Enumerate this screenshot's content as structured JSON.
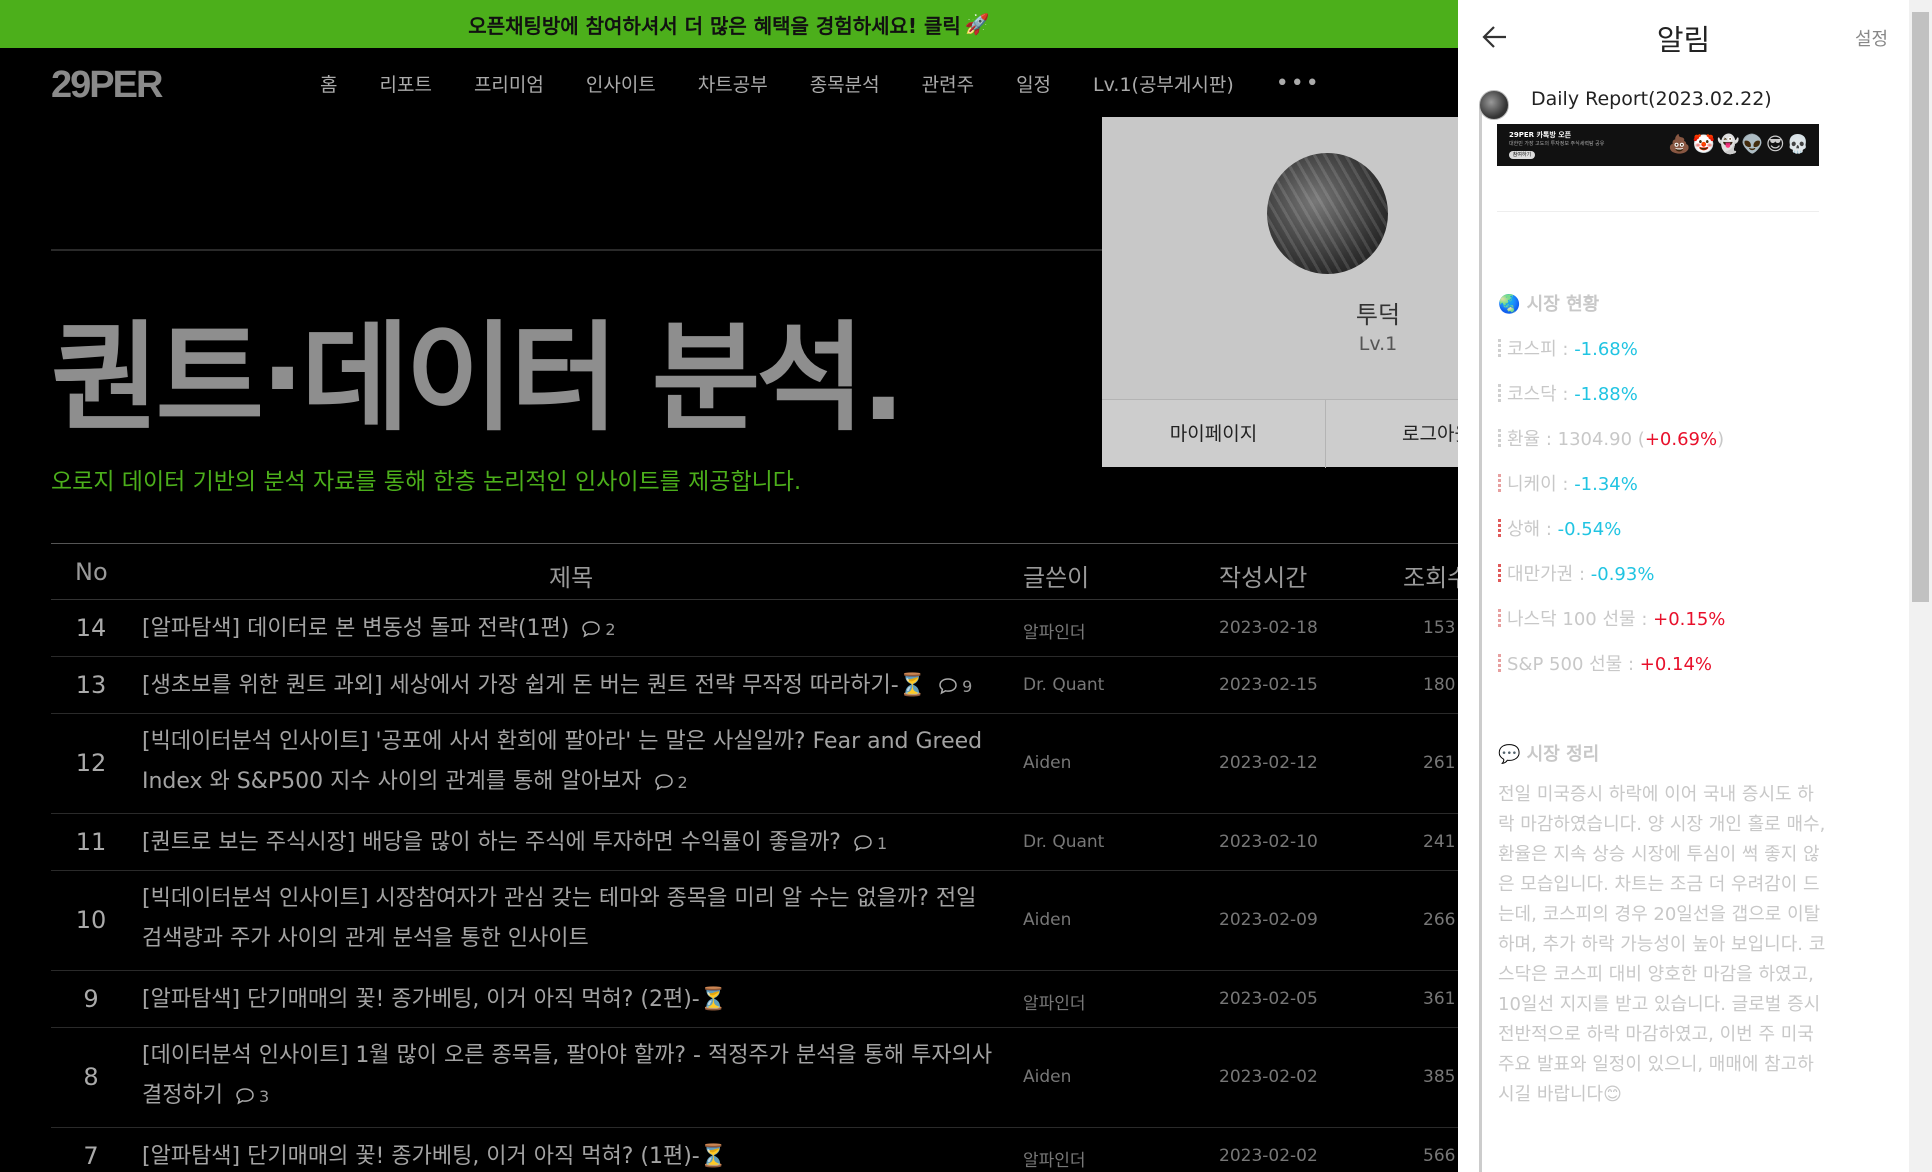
{
  "promo": {
    "text": "오픈채팅방에 참여하셔서 더 많은 혜택을 경험하세요! 클릭",
    "icon": "rocket-icon",
    "bg": "#4caf1b"
  },
  "header": {
    "logo": "29PER",
    "nav": [
      "홈",
      "리포트",
      "프리미엄",
      "인사이트",
      "차트공부",
      "종목분석",
      "관련주",
      "일정",
      "Lv.1(공부게시판)"
    ],
    "more": "•••"
  },
  "hero": {
    "title": "퀀트·데이터 분석.",
    "subtitle": "오로지 데이터 기반의 분석 자료를 통해 한층 논리적인 인사이트를 제공합니다."
  },
  "table": {
    "headers": {
      "no": "No",
      "title": "제목",
      "author": "글쓴이",
      "date": "작성시간",
      "views": "조회수"
    },
    "rows": [
      {
        "no": "14",
        "title": "[알파탐색] 데이터로 본 변동성 돌파 전략(1편)",
        "comments": "2",
        "author": "알파인더",
        "date": "2023-02-18",
        "views": "153"
      },
      {
        "no": "13",
        "title": "[생초보를 위한 퀀트 과외] 세상에서 가장 쉽게 돈 버는 퀀트 전략 무작정 따라하기-⏳",
        "comments": "9",
        "author": "Dr. Quant",
        "date": "2023-02-15",
        "views": "180"
      },
      {
        "no": "12",
        "title": "[빅데이터분석 인사이트] '공포에 사서 환희에 팔아라' 는 말은 사실일까? Fear and Greed Index 와 S&P500 지수 사이의 관계를 통해 알아보자",
        "comments": "2",
        "author": "Aiden",
        "date": "2023-02-12",
        "views": "261"
      },
      {
        "no": "11",
        "title": "[퀀트로 보는 주식시장] 배당을 많이 하는 주식에 투자하면 수익률이 좋을까?",
        "comments": "1",
        "author": "Dr. Quant",
        "date": "2023-02-10",
        "views": "241"
      },
      {
        "no": "10",
        "title": "[빅데이터분석 인사이트] 시장참여자가 관심 갖는 테마와 종목을 미리 알 수는 없을까? 전일 검색량과 주가 사이의 관계 분석을 통한 인사이트",
        "comments": "",
        "author": "Aiden",
        "date": "2023-02-09",
        "views": "266"
      },
      {
        "no": "9",
        "title": "[알파탐색] 단기매매의 꽃! 종가베팅, 이거 아직 먹혀? (2편)-⏳",
        "comments": "",
        "author": "알파인더",
        "date": "2023-02-05",
        "views": "361"
      },
      {
        "no": "8",
        "title": "[데이터분석 인사이트] 1월 많이 오른 종목들, 팔아야 할까? - 적정주가 분석을 통해 투자의사 결정하기",
        "comments": "3",
        "author": "Aiden",
        "date": "2023-02-02",
        "views": "385"
      },
      {
        "no": "7",
        "title": "[알파탐색] 단기매매의 꽃! 종가베팅, 이거 아직 먹혀? (1편)-⏳",
        "comments": "",
        "author": "알파인더",
        "date": "2023-02-02",
        "views": "566"
      }
    ]
  },
  "profile": {
    "name": "투덕",
    "level": "Lv.1",
    "mypage": "마이페이지",
    "logout": "로그아웃"
  },
  "panel": {
    "title": "알림",
    "settings": "설정",
    "report_title": "Daily Report(2023.02.22)",
    "thumb": {
      "line1": "29PER 카톡방 오픈",
      "line2": "대한민 가장 고도의 투자정보 주식세력탐 공유",
      "badge": "참여하기",
      "emojis": "💩🤡👻👽😎💀"
    },
    "market_section": "🌏 시장 현황",
    "market": [
      {
        "label": "코스피 : ",
        "value": "-1.68%",
        "sign": "neg",
        "bar": "grey"
      },
      {
        "label": "코스닥 : ",
        "value": "-1.88%",
        "sign": "neg",
        "bar": "grey"
      },
      {
        "label": "환율 : 1304.90 (",
        "value": "+0.69%",
        "sign": "pos",
        "suffix": ")",
        "bar": "grey"
      },
      {
        "label": "니케이 : ",
        "value": "-1.34%",
        "sign": "neg",
        "bar": "pink"
      },
      {
        "label": "상해 : ",
        "value": "-0.54%",
        "sign": "neg",
        "bar": "red"
      },
      {
        "label": "대만가권 : ",
        "value": "-0.93%",
        "sign": "neg",
        "bar": "red"
      },
      {
        "label": "나스닥 100 선물 : ",
        "value": "+0.15%",
        "sign": "pos",
        "bar": "pink"
      },
      {
        "label": "S&P 500 선물 : ",
        "value": "+0.14%",
        "sign": "pos",
        "bar": "pink"
      }
    ],
    "summary_section": "💬 시장 정리",
    "summary": "전일 미국증시 하락에 이어 국내 증시도 하락 마감하였습니다. 양 시장 개인 홀로 매수, 환율은 지속 상승 시장에 투심이 썩 좋지 않은 모습입니다. 차트는 조금 더 우려감이 드는데, 코스피의 경우 20일선을 갭으로 이탈하며, 추가 하락 가능성이 높아 보입니다. 코스닥은 코스피 대비 양호한 마감을 하였고, 10일선 지지를 받고 있습니다. 글로벌 증시 전반적으로 하락 마감하였고, 이번 주 미국 주요 발표와 일정이 있으니, 매매에 참고하시길 바랍니다😊"
  },
  "colors": {
    "accent_green": "#4caf1b",
    "negative": "#21c4e2",
    "positive": "#e8102b"
  }
}
